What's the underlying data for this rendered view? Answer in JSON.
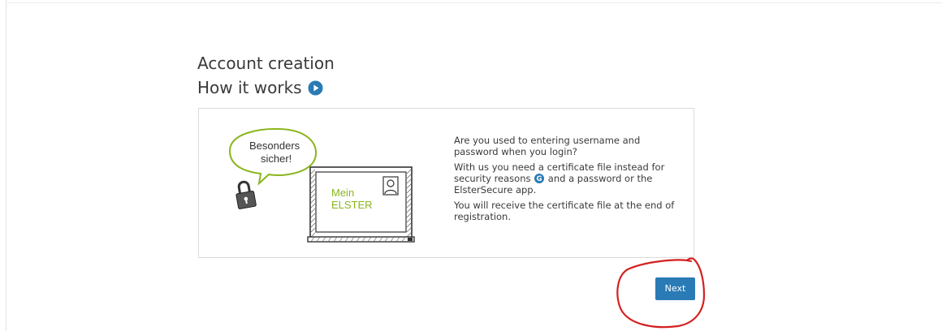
{
  "header": {
    "title": "Account creation",
    "subtitle": "How it works",
    "subtitle_icon": "play-circle-icon"
  },
  "card": {
    "illustration": {
      "speech_bubble_line1": "Besonders",
      "speech_bubble_line2": "sicher!",
      "screen_line1": "Mein",
      "screen_line2": "ELSTER",
      "icons": [
        "padlock-icon",
        "laptop-icon",
        "user-avatar-icon"
      ]
    },
    "paragraph1": "Are you used to entering username and password when you login?",
    "paragraph2_before": "With us you need a certificate file instead for security reasons",
    "paragraph2_icon": "glossary-g-icon",
    "paragraph2_after": "and a password or the ElsterSecure app.",
    "paragraph3": "You will receive the certificate file at the end of registration."
  },
  "actions": {
    "next_label": "Next"
  },
  "colors": {
    "accent": "#2a7bb5",
    "illustration_green": "#8ab61d",
    "annotation_red": "#d42020"
  }
}
